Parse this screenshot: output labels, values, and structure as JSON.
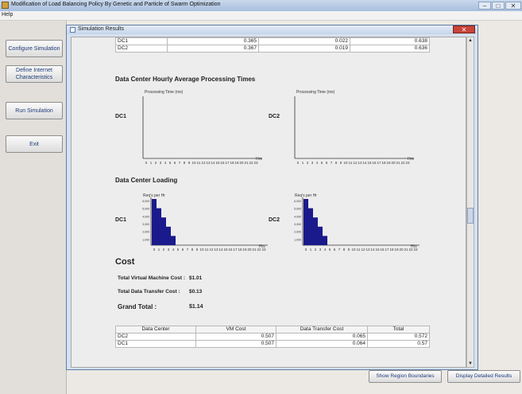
{
  "window": {
    "title": "Modification of Load Balancing Policy By Genetic and Particle of Swarm Optimization",
    "minimize": "–",
    "maximize": "□",
    "close": "✕"
  },
  "menu": {
    "help": "Help"
  },
  "sidebar": {
    "configure": "Configure Simulation",
    "define_internet": "Define Internet Characteristics",
    "run": "Run Simulation",
    "exit": "Exit"
  },
  "dialog": {
    "title": "Simulation Results",
    "close": "✕",
    "top_table": [
      [
        "DC1",
        "0.365",
        "0.022",
        "0.638"
      ],
      [
        "DC2",
        "0.367",
        "0.019",
        "0.636"
      ]
    ],
    "processing_title": "Data Center Hourly Average Processing Times",
    "processing_axis": "Processing Time (ms)",
    "loading_title": "Data Center Loading",
    "loading_axis": "Req's per Hr",
    "dc1": "DC1",
    "dc2": "DC2",
    "hrs": "Hrs",
    "cost": {
      "title": "Cost",
      "vm_label": "Total Virtual Machine Cost :",
      "vm_value": "$1.01",
      "dt_label": "Total Data Transfer Cost :",
      "dt_value": "$0.13",
      "grand_label": "Grand Total :",
      "grand_value": "$1.14"
    },
    "cost_table": {
      "headers": [
        "Data Center",
        "VM Cost",
        "Data Transfer Cost",
        "Total"
      ],
      "rows": [
        [
          "DC2",
          "0.507",
          "0.065",
          "0.572"
        ],
        [
          "DC1",
          "0.507",
          "0.064",
          "0.57"
        ]
      ]
    }
  },
  "buttons": {
    "show_region": "Show Region Boundaries",
    "display_detailed": "Display Detailed Results"
  },
  "chart_data": [
    {
      "type": "bar",
      "title": "Data Center Loading",
      "series_label": "DC1",
      "ylabel": "Req's per Hr",
      "xlabel": "Hrs",
      "categories": [
        "0",
        "1",
        "2",
        "3",
        "4",
        "5",
        "6",
        "7",
        "8",
        "9",
        "10",
        "11",
        "12",
        "13",
        "14",
        "15",
        "16",
        "17",
        "18",
        "19",
        "20",
        "21",
        "22",
        "23"
      ],
      "values": [
        6000,
        4800,
        3600,
        2400,
        1200,
        0,
        0,
        0,
        0,
        0,
        0,
        0,
        0,
        0,
        0,
        0,
        0,
        0,
        0,
        0,
        0,
        0,
        0,
        0
      ],
      "yticks": [
        "1,000",
        "2,000",
        "3,000",
        "4,000",
        "5,000",
        "6,000"
      ]
    },
    {
      "type": "bar",
      "title": "Data Center Loading",
      "series_label": "DC2",
      "ylabel": "Req's per Hr",
      "xlabel": "Hrs",
      "categories": [
        "0",
        "1",
        "2",
        "3",
        "4",
        "5",
        "6",
        "7",
        "8",
        "9",
        "10",
        "11",
        "12",
        "13",
        "14",
        "15",
        "16",
        "17",
        "18",
        "19",
        "20",
        "21",
        "22",
        "23"
      ],
      "values": [
        6000,
        4800,
        3600,
        2400,
        1200,
        0,
        0,
        0,
        0,
        0,
        0,
        0,
        0,
        0,
        0,
        0,
        0,
        0,
        0,
        0,
        0,
        0,
        0,
        0
      ],
      "yticks": [
        "1,000",
        "2,000",
        "3,000",
        "4,000",
        "5,000",
        "6,000"
      ]
    }
  ]
}
